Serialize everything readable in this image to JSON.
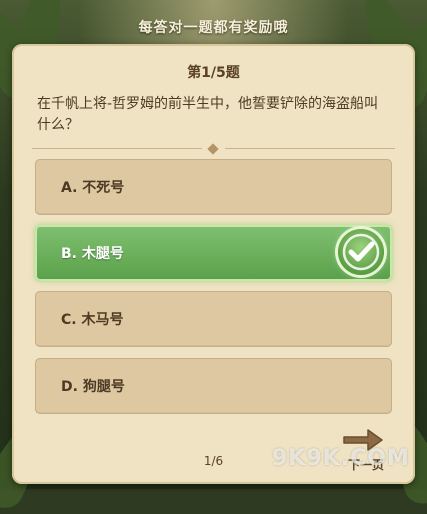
{
  "header": {
    "banner_text": "每答对一题都有奖励哦"
  },
  "quiz": {
    "counter": "第1/5题",
    "question": "在千帆上将-哲罗姆的前半生中，他誓要铲除的海盗船叫什么？",
    "options": [
      {
        "label": "A. 不死号",
        "state": "default"
      },
      {
        "label": "B. 木腿号",
        "state": "correct"
      },
      {
        "label": "C. 木马号",
        "state": "default"
      },
      {
        "label": "D. 狗腿号",
        "state": "default"
      }
    ],
    "correct_icon": "checkmark-icon",
    "page_indicator": "1/6",
    "next_label": "下一页",
    "next_icon": "arrow-right-icon"
  },
  "watermark": "9K9K.COM",
  "colors": {
    "card": "#efe3c4",
    "option": "#ddc8a2",
    "correct": "#5aa04a",
    "text": "#4d3a22"
  }
}
